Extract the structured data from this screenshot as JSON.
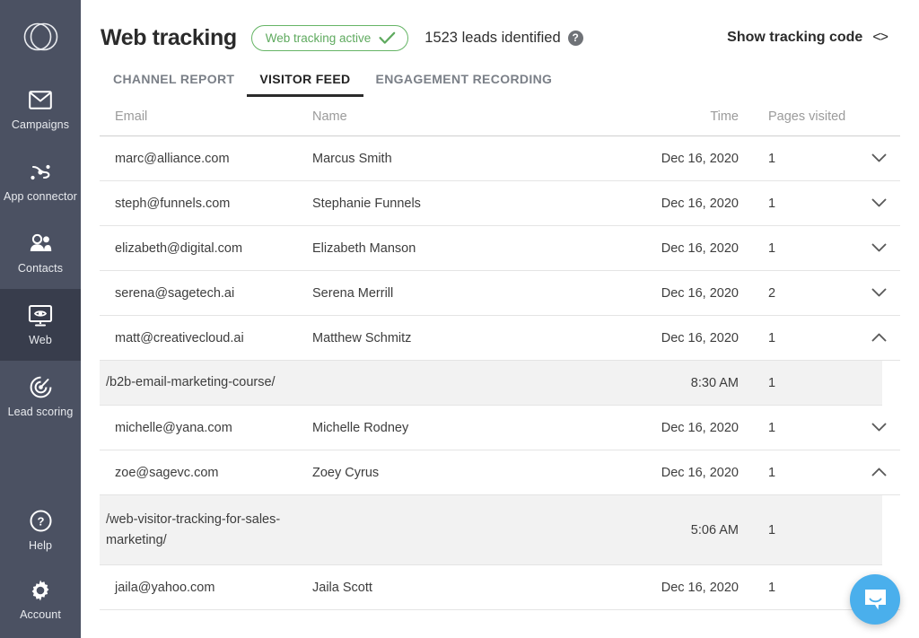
{
  "sidebar": {
    "logo_name": "overlapping-circles-logo",
    "items": [
      {
        "label": "Campaigns",
        "icon": "envelope-icon",
        "active": false
      },
      {
        "label": "App connector",
        "icon": "nodes-icon",
        "active": false
      },
      {
        "label": "Contacts",
        "icon": "people-icon",
        "active": false
      },
      {
        "label": "Web",
        "icon": "monitor-eye-icon",
        "active": true
      },
      {
        "label": "Lead scoring",
        "icon": "target-icon",
        "active": false
      }
    ],
    "bottom_items": [
      {
        "label": "Help",
        "icon": "question-circle-icon"
      },
      {
        "label": "Account",
        "icon": "gear-icon"
      }
    ]
  },
  "header": {
    "title": "Web tracking",
    "status_label": "Web tracking active",
    "status_color": "#66b566",
    "leads_text": "1523 leads identified",
    "help_glyph": "?",
    "show_code_label": "Show tracking code",
    "code_glyph": "<>"
  },
  "tabs": [
    {
      "label": "CHANNEL REPORT",
      "active": false
    },
    {
      "label": "VISITOR FEED",
      "active": true
    },
    {
      "label": "ENGAGEMENT RECORDING",
      "active": false
    }
  ],
  "table": {
    "columns": {
      "email": "Email",
      "name": "Name",
      "time": "Time",
      "pages": "Pages visited"
    },
    "rows": [
      {
        "type": "visitor",
        "email": "marc@alliance.com",
        "name": "Marcus Smith",
        "time": "Dec 16, 2020",
        "pages": "1",
        "expanded": false,
        "chevron": "chevron-down"
      },
      {
        "type": "visitor",
        "email": "steph@funnels.com",
        "name": "Stephanie Funnels",
        "time": "Dec 16, 2020",
        "pages": "1",
        "expanded": false,
        "chevron": "chevron-down"
      },
      {
        "type": "visitor",
        "email": "elizabeth@digital.com",
        "name": "Elizabeth Manson",
        "time": "Dec 16, 2020",
        "pages": "1",
        "expanded": false,
        "chevron": "chevron-down"
      },
      {
        "type": "visitor",
        "email": "serena@sagetech.ai",
        "name": "Serena Merrill",
        "time": "Dec 16, 2020",
        "pages": "2",
        "expanded": false,
        "chevron": "chevron-down"
      },
      {
        "type": "visitor",
        "email": "matt@creativecloud.ai",
        "name": "Matthew Schmitz",
        "time": "Dec 16, 2020",
        "pages": "1",
        "expanded": true,
        "chevron": "chevron-up"
      },
      {
        "type": "page",
        "email": "/b2b-email-marketing-course/",
        "name": "",
        "time": "8:30 AM",
        "pages": "1",
        "tall": false
      },
      {
        "type": "visitor",
        "email": "michelle@yana.com",
        "name": "Michelle Rodney",
        "time": "Dec 16, 2020",
        "pages": "1",
        "expanded": false,
        "chevron": "chevron-down"
      },
      {
        "type": "visitor",
        "email": "zoe@sagevc.com",
        "name": "Zoey Cyrus",
        "time": "Dec 16, 2020",
        "pages": "1",
        "expanded": true,
        "chevron": "chevron-up"
      },
      {
        "type": "page",
        "email": "/web-visitor-tracking-for-sales-marketing/",
        "name": "",
        "time": "5:06 AM",
        "pages": "1",
        "tall": true
      },
      {
        "type": "visitor",
        "email": "jaila@yahoo.com",
        "name": "Jaila Scott",
        "time": "Dec 16, 2020",
        "pages": "1",
        "expanded": false,
        "chevron": "chevron-down"
      }
    ]
  },
  "widgets": {
    "intercom_label": "chat-bubble-icon",
    "intercom_color": "#4aafec"
  }
}
